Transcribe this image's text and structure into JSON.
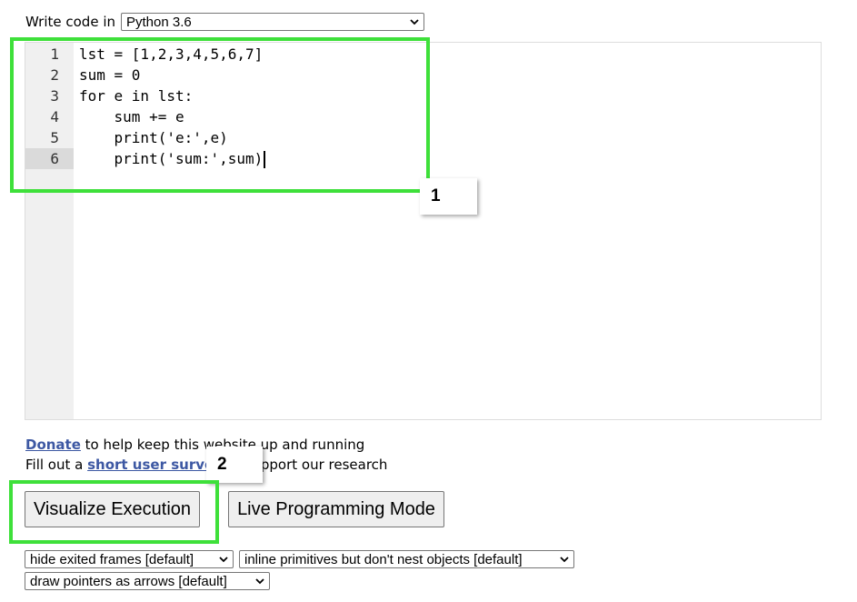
{
  "language_picker": {
    "label": "Write code in",
    "selected": "Python 3.6"
  },
  "editor": {
    "line_numbers": [
      "1",
      "2",
      "3",
      "4",
      "5",
      "6"
    ],
    "active_line": "6",
    "lines": [
      "lst = [1,2,3,4,5,6,7]",
      "sum = 0",
      "for e in lst:",
      "    sum += e",
      "    print('e:',e)",
      "    print('sum:',sum)"
    ]
  },
  "callouts": {
    "one": "1",
    "two": "2"
  },
  "info": {
    "donate_link": "Donate",
    "donate_text": " to help keep this website up and running",
    "survey_prefix": "Fill out a ",
    "survey_link": "short user survey",
    "survey_suffix": " to support our research"
  },
  "buttons": {
    "visualize": "Visualize Execution",
    "live": "Live Programming Mode"
  },
  "options": {
    "frames": "hide exited frames [default]",
    "primitives": "inline primitives but don't nest objects [default]",
    "pointers": "draw pointers as arrows [default]"
  },
  "colors": {
    "highlight_green": "#3ee03a",
    "link_blue": "#3d58a3",
    "keyword_blue": "#0000cc",
    "string_green": "#1a7a1a"
  }
}
